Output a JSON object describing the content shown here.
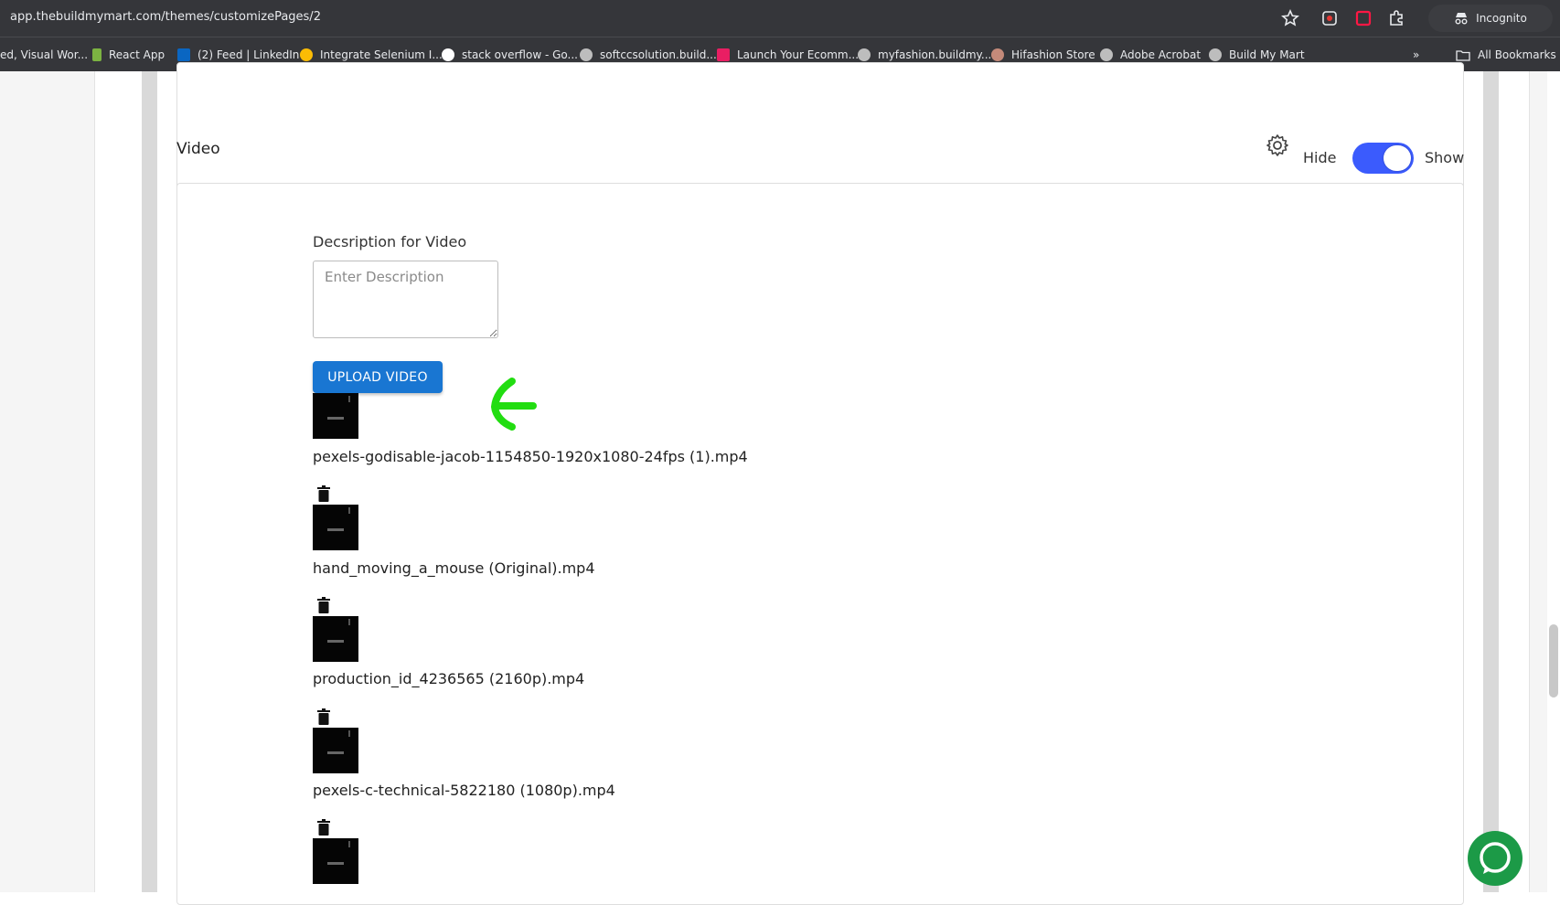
{
  "browser": {
    "url": "app.thebuildmymart.com/themes/customizePages/2",
    "profile_label": "Incognito",
    "bookmarks": [
      {
        "label": "ed, Visual Wor...",
        "color": ""
      },
      {
        "label": "React App",
        "color": "#7cb342"
      },
      {
        "label": "(2) Feed | LinkedIn",
        "color": "#0a66c2"
      },
      {
        "label": "Integrate Selenium I...",
        "color": "#fbbc05"
      },
      {
        "label": "stack overflow - Go...",
        "color": "#ffffff"
      },
      {
        "label": "softccsolution.build...",
        "color": "#bdbdbd"
      },
      {
        "label": "Launch Your Ecomm...",
        "color": "#e91e63"
      },
      {
        "label": "myfashion.buildmy...",
        "color": "#bdbdbd"
      },
      {
        "label": "Hifashion Store",
        "color": "#c48a7a"
      },
      {
        "label": "Adobe Acrobat",
        "color": "#bdbdbd"
      },
      {
        "label": "Build My Mart",
        "color": "#bdbdbd"
      }
    ],
    "all_bookmarks_label": "All Bookmarks"
  },
  "section": {
    "title": "Video",
    "hide_label": "Hide",
    "show_label": "Show",
    "toggle_on": true
  },
  "form": {
    "description_label": "Decsription for Video",
    "description_placeholder": "Enter Description",
    "description_value": "",
    "upload_button_label": "UPLOAD VIDEO"
  },
  "videos": [
    {
      "filename": "pexels-godisable-jacob-1154850-1920x1080-24fps (1).mp4"
    },
    {
      "filename": "hand_moving_a_mouse (Original).mp4"
    },
    {
      "filename": "production_id_4236565 (2160p).mp4"
    },
    {
      "filename": "pexels-c-technical-5822180 (1080p).mp4"
    },
    {
      "filename": ""
    }
  ],
  "colors": {
    "toggle_accent": "#3b5bfd",
    "upload_button": "#1976d2",
    "annotation_arrow": "#22dd11",
    "chat_button": "#1c9a47"
  }
}
